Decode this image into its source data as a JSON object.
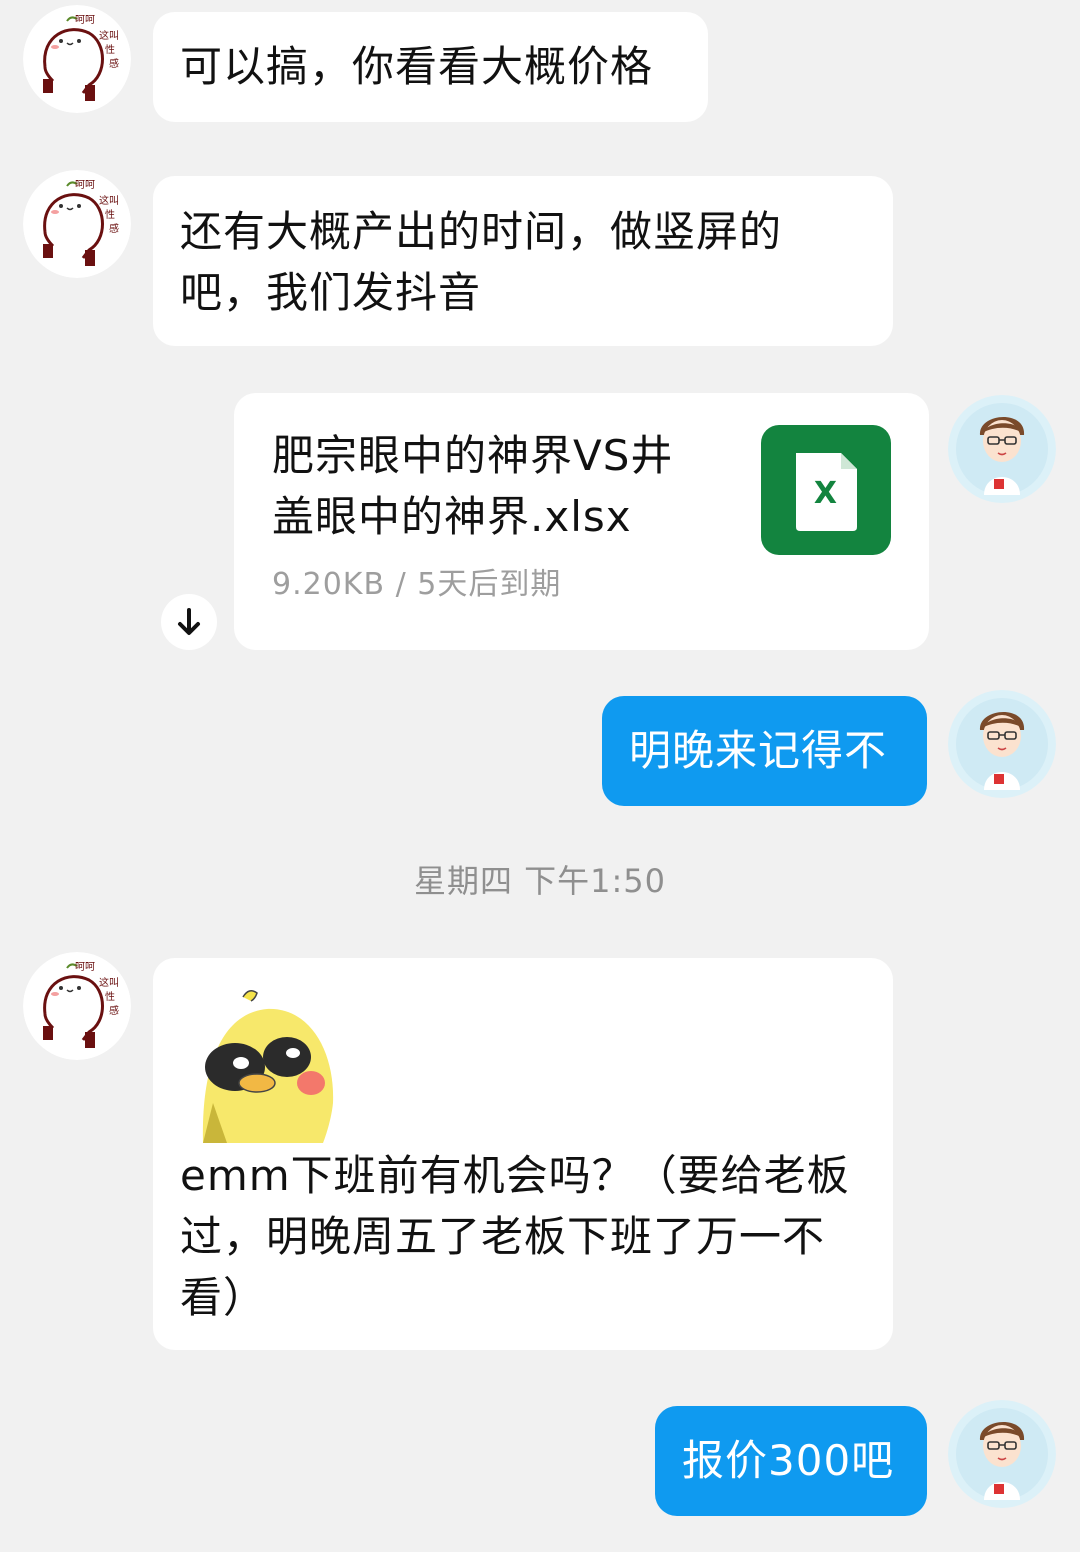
{
  "messages": [
    {
      "sender": "contact",
      "text": "可以搞，你看看大概价格"
    },
    {
      "sender": "contact",
      "lines": [
        "还有大概产出的时间，做竖屏的",
        "吧，我们发抖音"
      ]
    },
    {
      "sender": "me",
      "type": "file",
      "file_name_lines": [
        "肥宗眼中的神界VS井",
        "盖眼中的神界.xlsx"
      ],
      "file_meta": "9.20KB / 5天后到期",
      "file_icon_letter": "X"
    },
    {
      "sender": "me",
      "text": "明晚来记得不"
    },
    {
      "sender": "contact",
      "type": "sticker_text",
      "lines": [
        "emm下班前有机会吗？（要给老板",
        "过，明晚周五了老板下班了万一不",
        "看）"
      ]
    },
    {
      "sender": "me",
      "text": "报价300吧"
    }
  ],
  "timestamp": "星期四 下午1:50",
  "contact_avatar": {
    "caption": "呵呵 这叫 性感"
  },
  "icons": {
    "download": "download-arrow-icon",
    "excel": "excel-file-icon"
  },
  "colors": {
    "background": "#f1f1f1",
    "incoming_bubble": "#ffffff",
    "outgoing_bubble": "#0f9af0",
    "excel_green": "#13843f"
  }
}
